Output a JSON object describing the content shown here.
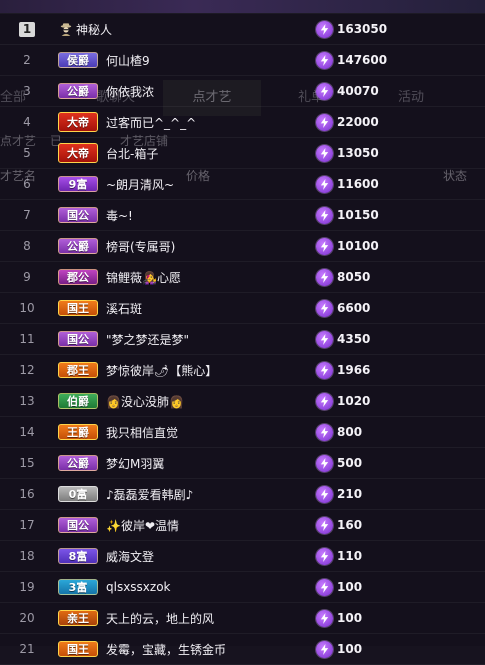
{
  "background": {
    "tabs": [
      {
        "label": "全部"
      },
      {
        "label": "歌聊天"
      },
      {
        "label": "点才艺"
      },
      {
        "label": "礼单"
      },
      {
        "label": "活动"
      }
    ],
    "filters": {
      "left": "点才艺",
      "mid": "已",
      "right": "才艺店铺"
    },
    "columns": {
      "name": "才艺名",
      "price": "价格",
      "status": "状态"
    }
  },
  "ranking": [
    {
      "rank": "1",
      "badge": "",
      "badge_style": "anon",
      "name": "神秘人",
      "score": "163050"
    },
    {
      "rank": "2",
      "badge": "侯爵",
      "badge_style": "b-hou",
      "name": "何山楂9",
      "score": "147600"
    },
    {
      "rank": "3",
      "badge": "公爵",
      "badge_style": "b-gong",
      "name": "你依我浓",
      "score": "40070"
    },
    {
      "rank": "4",
      "badge": "大帝",
      "badge_style": "b-di",
      "name": "过客而已^_^_^",
      "score": "22000"
    },
    {
      "rank": "5",
      "badge": "大帝",
      "badge_style": "b-di",
      "name": "台北-箱子",
      "score": "13050"
    },
    {
      "rank": "6",
      "badge": "9富",
      "badge_style": "b-fu9",
      "name": "~朗月清风~",
      "score": "11600"
    },
    {
      "rank": "7",
      "badge": "国公",
      "badge_style": "b-gong",
      "name": "毒~!",
      "score": "10150"
    },
    {
      "rank": "8",
      "badge": "公爵",
      "badge_style": "b-gong",
      "name": "榜哥(专属哥)",
      "score": "10100"
    },
    {
      "rank": "9",
      "badge": "郡公",
      "badge_style": "b-jun",
      "name": "锦鲤薇👩‍🎤心愿",
      "score": "8050"
    },
    {
      "rank": "10",
      "badge": "国王",
      "badge_style": "b-wang",
      "name": "溪石斑",
      "score": "6600"
    },
    {
      "rank": "11",
      "badge": "国公",
      "badge_style": "b-gong",
      "name": "\"梦之梦还是梦\"",
      "score": "4350"
    },
    {
      "rank": "12",
      "badge": "郡王",
      "badge_style": "b-wang",
      "name": "梦惊彼岸🌶【熊心】",
      "score": "1966"
    },
    {
      "rank": "13",
      "badge": "伯爵",
      "badge_style": "b-bo",
      "name": "👩没心没肺👩",
      "score": "1020"
    },
    {
      "rank": "14",
      "badge": "王爵",
      "badge_style": "b-wang",
      "name": "我只相信直觉",
      "score": "800"
    },
    {
      "rank": "15",
      "badge": "公爵",
      "badge_style": "b-gong",
      "name": "梦幻M羽翼",
      "score": "500"
    },
    {
      "rank": "16",
      "badge": "0富",
      "badge_style": "b-fu0",
      "name": "♪磊磊爱看韩剧♪",
      "score": "210"
    },
    {
      "rank": "17",
      "badge": "国公",
      "badge_style": "b-gong",
      "name": "✨彼岸❤温情",
      "score": "160"
    },
    {
      "rank": "18",
      "badge": "8富",
      "badge_style": "b-fu8",
      "name": "威海文登",
      "score": "110"
    },
    {
      "rank": "19",
      "badge": "3富",
      "badge_style": "b-fu3",
      "name": "qlsxssxzok",
      "score": "100"
    },
    {
      "rank": "20",
      "badge": "亲王",
      "badge_style": "b-qin",
      "name": "天上的云，地上的风",
      "score": "100"
    },
    {
      "rank": "21",
      "badge": "国王",
      "badge_style": "b-wang",
      "name": "发霉，宝藏，生锈金币",
      "score": "100"
    }
  ],
  "anon_icon": "spy-icon",
  "score_icon": "lightning-bolt-icon",
  "colors": {
    "bolt": "#8a3be0",
    "background": "#17131f"
  }
}
